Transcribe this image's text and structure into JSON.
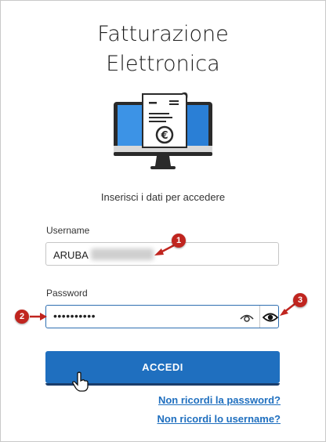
{
  "header": {
    "title_line1": "Fatturazione",
    "title_line2": "Elettronica",
    "subtitle": "Inserisci i dati per accedere"
  },
  "form": {
    "username_label": "Username",
    "username_value": "ARUBA",
    "password_label": "Password",
    "password_value": "••••••••••",
    "show_password_icon": "eye-outline-icon",
    "toggle_icon": "eye-icon",
    "submit_label": "ACCEDI"
  },
  "links": {
    "forgot_password": "Non ricordi la password?",
    "forgot_username": "Non ricordi lo username?"
  },
  "annotations": {
    "badge1": "1",
    "badge2": "2",
    "badge3": "3"
  },
  "colors": {
    "accent": "#1f6fbf",
    "annotation": "#c0251f"
  }
}
